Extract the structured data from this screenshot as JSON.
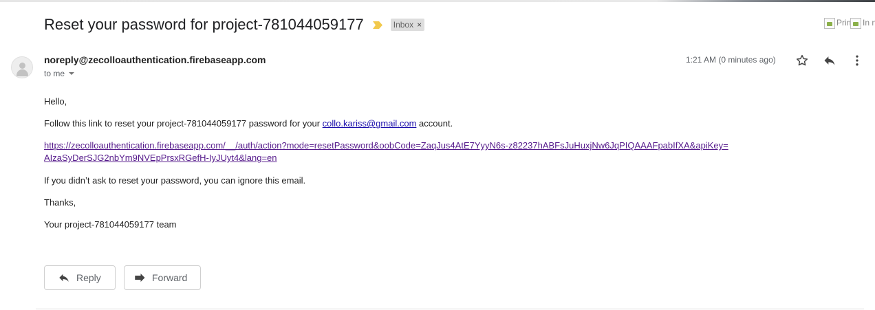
{
  "email": {
    "subject": "Reset your password for project-781044059177",
    "label": "Inbox",
    "label_remove": "×",
    "print_alt": "Print all",
    "sender": "noreply@zecolloauthentication.firebaseapp.com",
    "recipient": "to me",
    "date": "1:21 AM (0 minutes ago)",
    "greeting": "Hello,",
    "instruction_prefix": "Follow this link to reset your project-781044059177 password for your",
    "account_email": "collo.kariss@gmail.com",
    "instruction_suffix": "account.",
    "reset_link_line1": "https://zecolloauthentication.firebaseapp.com/__/auth/action?mode=resetPassword&oobCode=ZaqJus4AtE7YyyN6s-z82237hABFsJuHuxjNw6JqPIQAAAFpabIfXA&apiKey=",
    "reset_link_line2": "AIzaSyDerSJG2nbYm9NVEpPrsxRGefH-IyJUyt4&lang=en",
    "ignore_note": "If you didn’t ask to reset your password, you can ignore this email.",
    "thanks": "Thanks,",
    "signature": "Your project-781044059177 team"
  },
  "actions": {
    "reply_label": "Reply",
    "forward_label": "Forward"
  },
  "icons": {
    "importance": "importance-marker-icon",
    "star": "star-icon",
    "reply": "reply-icon",
    "more": "more-vert-icon",
    "forward": "forward-icon",
    "avatar": "default-avatar-icon"
  },
  "colors": {
    "importance": "#f2c94c",
    "link": "#1a0dab",
    "link_visited": "#551a8b",
    "chip_bg": "#dddddd"
  }
}
